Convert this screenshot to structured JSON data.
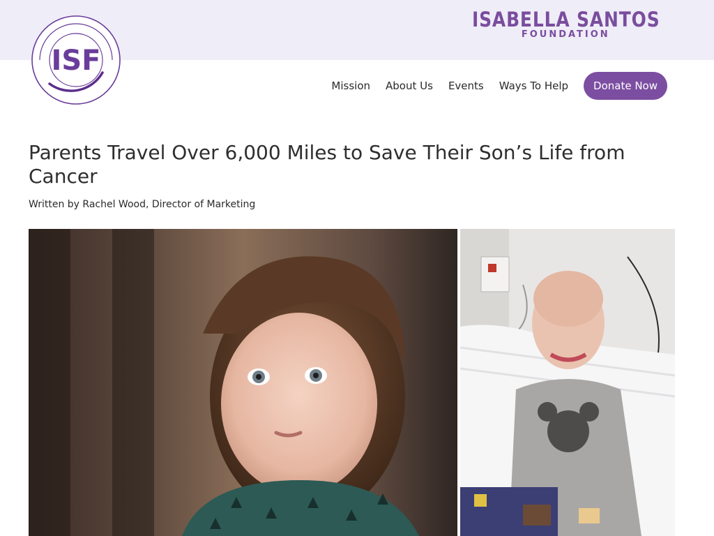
{
  "logo": {
    "text": "ISF",
    "color": "#6a3d9a"
  },
  "brand": {
    "name": "ISABELLA SANTOS",
    "subtitle": "FOUNDATION",
    "color": "#7a4d9e"
  },
  "nav": {
    "items": [
      "Mission",
      "About Us",
      "Events",
      "Ways To Help"
    ],
    "donate_label": "Donate Now",
    "accent": "#7c4ea1"
  },
  "article": {
    "title": "Parents Travel Over 6,000 Miles to Save Their Son’s Life from Cancer",
    "byline": "Written by Rachel Wood, Director of Marketing"
  },
  "photos": {
    "left": "portrait-of-toddler",
    "right": "child-in-hospital-bed-playing-lego"
  }
}
